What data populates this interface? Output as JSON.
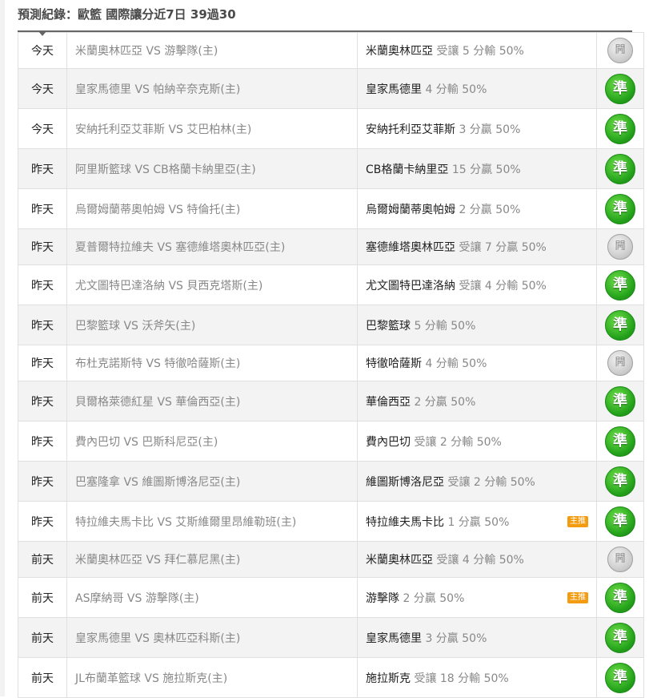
{
  "header": {
    "title": "預測紀錄：歐籃 國際讓分近7日 39過30"
  },
  "rows": [
    {
      "day": "今天",
      "match": "米蘭奧林匹亞 VS 游擊隊(主)",
      "pick_team": "米蘭奧林匹亞",
      "pick_detail": "受讓 5 分輸 50%",
      "tag": "",
      "result": "闁",
      "result_type": "push"
    },
    {
      "day": "今天",
      "match": "皇家馬德里 VS 帕納辛奈克斯(主)",
      "pick_team": "皇家馬德里",
      "pick_detail": "4 分輸 50%",
      "tag": "",
      "result": "準",
      "result_type": "win"
    },
    {
      "day": "今天",
      "match": "安納托利亞艾菲斯 VS 艾巴柏林(主)",
      "pick_team": "安納托利亞艾菲斯",
      "pick_detail": "3 分贏 50%",
      "tag": "",
      "result": "準",
      "result_type": "win"
    },
    {
      "day": "昨天",
      "match": "阿里斯籃球 VS CB格蘭卡納里亞(主)",
      "pick_team": "CB格蘭卡納里亞",
      "pick_detail": "15 分贏 50%",
      "tag": "",
      "result": "準",
      "result_type": "win"
    },
    {
      "day": "昨天",
      "match": "烏爾姆蘭蒂奧帕姆 VS 特倫托(主)",
      "pick_team": "烏爾姆蘭蒂奧帕姆",
      "pick_detail": "2 分贏 50%",
      "tag": "",
      "result": "準",
      "result_type": "win"
    },
    {
      "day": "昨天",
      "match": "夏普爾特拉維夫 VS 塞德維塔奧林匹亞(主)",
      "pick_team": "塞德維塔奧林匹亞",
      "pick_detail": "受讓 7 分贏 50%",
      "tag": "",
      "result": "闁",
      "result_type": "push"
    },
    {
      "day": "昨天",
      "match": "尤文圖特巴達洛納 VS 貝西克塔斯(主)",
      "pick_team": "尤文圖特巴達洛納",
      "pick_detail": "受讓 4 分輸 50%",
      "tag": "",
      "result": "準",
      "result_type": "win"
    },
    {
      "day": "昨天",
      "match": "巴黎籃球 VS 沃斧矢(主)",
      "pick_team": "巴黎籃球",
      "pick_detail": "5 分輸 50%",
      "tag": "",
      "result": "準",
      "result_type": "win"
    },
    {
      "day": "昨天",
      "match": "布杜克諾斯特 VS 特徹哈薩斯(主)",
      "pick_team": "特徹哈薩斯",
      "pick_detail": "4 分輸 50%",
      "tag": "",
      "result": "闁",
      "result_type": "push"
    },
    {
      "day": "昨天",
      "match": "貝爾格萊德紅星 VS 華倫西亞(主)",
      "pick_team": "華倫西亞",
      "pick_detail": "2 分贏 50%",
      "tag": "",
      "result": "準",
      "result_type": "win"
    },
    {
      "day": "昨天",
      "match": "費內巴切 VS 巴斯科尼亞(主)",
      "pick_team": "費內巴切",
      "pick_detail": "受讓 2 分輸 50%",
      "tag": "",
      "result": "準",
      "result_type": "win"
    },
    {
      "day": "昨天",
      "match": "巴塞隆拿 VS 維圖斯博洛尼亞(主)",
      "pick_team": "維圖斯博洛尼亞",
      "pick_detail": "受讓 2 分輸 50%",
      "tag": "",
      "result": "準",
      "result_type": "win"
    },
    {
      "day": "昨天",
      "match": "特拉維夫馬卡比 VS 艾斯維爾里昂維勒班(主)",
      "pick_team": "特拉維夫馬卡比",
      "pick_detail": "1 分贏 50%",
      "tag": "主推",
      "result": "準",
      "result_type": "win"
    },
    {
      "day": "前天",
      "match": "米蘭奧林匹亞 VS 拜仁慕尼黑(主)",
      "pick_team": "米蘭奧林匹亞",
      "pick_detail": "受讓 4 分輸 50%",
      "tag": "",
      "result": "闁",
      "result_type": "push"
    },
    {
      "day": "前天",
      "match": "AS摩納哥 VS 游擊隊(主)",
      "pick_team": "游擊隊",
      "pick_detail": "2 分贏 50%",
      "tag": "主推",
      "result": "準",
      "result_type": "win"
    },
    {
      "day": "前天",
      "match": "皇家馬德里 VS 奧林匹亞科斯(主)",
      "pick_team": "皇家馬德里",
      "pick_detail": "3 分贏 50%",
      "tag": "",
      "result": "準",
      "result_type": "win"
    },
    {
      "day": "前天",
      "match": "JL布蘭革籃球 VS 施拉斯克(主)",
      "pick_team": "施拉斯克",
      "pick_detail": "受讓 18 分輸 50%",
      "tag": "",
      "result": "準",
      "result_type": "win"
    }
  ]
}
